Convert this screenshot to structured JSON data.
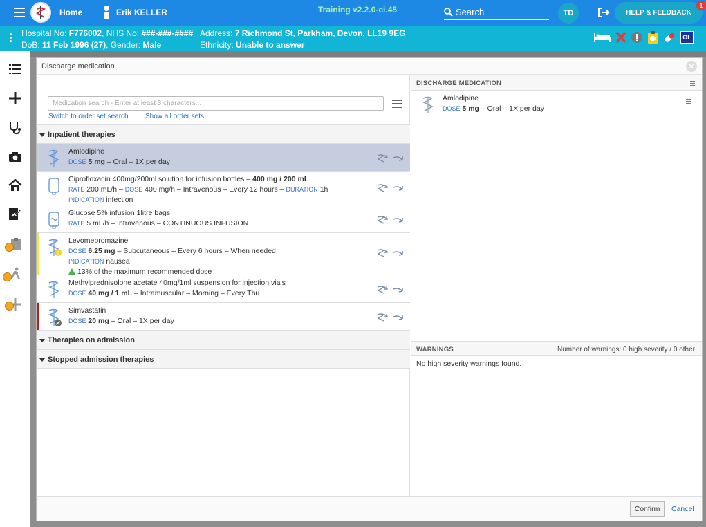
{
  "header": {
    "home_label": "Home",
    "user_name": "Erik KELLER",
    "training": "Training v2.2.0-ci.45",
    "search_label": "Search",
    "avatar_initials": "TD",
    "help_label": "HELP & FEEDBACK",
    "notification_count": "1"
  },
  "patient": {
    "line1_left": "Hospital No: ",
    "hospital_no": "F776002",
    "nhs_label": ", NHS No: ",
    "nhs_no": "###-###-####",
    "dob_label": "DoB: ",
    "dob": "11 Feb 1996 (27)",
    "gender_label": ", Gender: ",
    "gender": "Male",
    "address_label": "Address: ",
    "address": "7 Richmond St, Parkham, Devon, LL19 9EG",
    "ethnicity_label": "Ethnicity: ",
    "ethnicity": "Unable to answer",
    "ol_badge": "OL"
  },
  "modal": {
    "title": "Discharge medication",
    "search_placeholder": "Medication search - Enter at least 3 characters...",
    "link_order_set": "Switch to order set search",
    "link_show_all": "Show all order sets",
    "sections": {
      "inpatient": "Inpatient therapies",
      "admission": "Therapies on admission",
      "stopped": "Stopped admission therapies"
    },
    "therapies": [
      {
        "name": "Amlodipine",
        "l1a": "DOSE",
        "v1": " 5 mg",
        "r1": " – Oral – 1X per day"
      },
      {
        "name_a": "Ciprofloxacin 400mg/200ml solution for infusion bottles – ",
        "name_b": "400 mg / 200 mL",
        "rate_lbl": "RATE",
        "rate": " 200 mL/h – ",
        "dose_lbl": "DOSE",
        "dose": " 400 mg/h – Intravenous – Every 12 hours – ",
        "dur_lbl": "DURATION",
        "dur": " 1h",
        "ind_lbl": "INDICATION",
        "ind": " infection"
      },
      {
        "name": "Glucose 5% infusion 1litre bags",
        "rate_lbl": "RATE",
        "rest": " 5 mL/h – Intravenous – CONTINUOUS INFUSION"
      },
      {
        "name": "Levomepromazine",
        "dose_lbl": "DOSE",
        "dose": " 6.25 mg",
        "rest": " – Subcutaneous – Every 6 hours – When needed",
        "ind_lbl": "INDICATION",
        "ind": " nausea",
        "warn": "13% of the maximum recommended dose"
      },
      {
        "name": "Methylprednisolone acetate 40mg/1ml suspension for injection vials",
        "dose_lbl": "DOSE",
        "dose": " 40 mg / 1 mL",
        "rest": " – Intramuscular – Morning – Every Thu"
      },
      {
        "name": "Simvastatin",
        "dose_lbl": "DOSE",
        "dose": " 20 mg",
        "rest": " – Oral – 1X per day"
      }
    ],
    "discharge": {
      "header": "Discharge medication",
      "item_name": "Amlodipine",
      "dose_lbl": "DOSE",
      "dose": " 5 mg",
      "rest": " – Oral – 1X per day"
    },
    "warnings": {
      "header": "Warnings",
      "summary": "Number of warnings: 0 high severity / 0 other",
      "text": "No high severity warnings found."
    },
    "confirm": "Confirm",
    "cancel": "Cancel"
  },
  "colors": {
    "topbar": "#1e88e5",
    "patientbar": "#13b5d6",
    "selected_row": "#c6cddf",
    "link": "#1e6fbf"
  }
}
